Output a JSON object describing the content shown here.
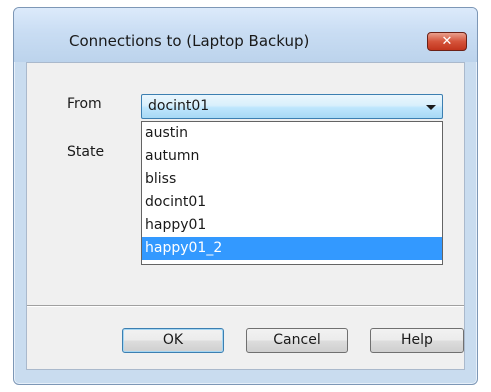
{
  "dialog": {
    "title": "Connections to (Laptop Backup)",
    "close_glyph": "✕"
  },
  "form": {
    "from_label": "From",
    "state_label": "State",
    "from_selected": "docint01"
  },
  "dropdown": {
    "options": [
      "austin",
      "autumn",
      "bliss",
      "docint01",
      "happy01",
      "happy01_2"
    ],
    "highlighted": "happy01_2"
  },
  "buttons": {
    "ok": "OK",
    "cancel": "Cancel",
    "help": "Help"
  },
  "colors": {
    "highlight": "#3399ff",
    "close_button": "#c2351d"
  }
}
